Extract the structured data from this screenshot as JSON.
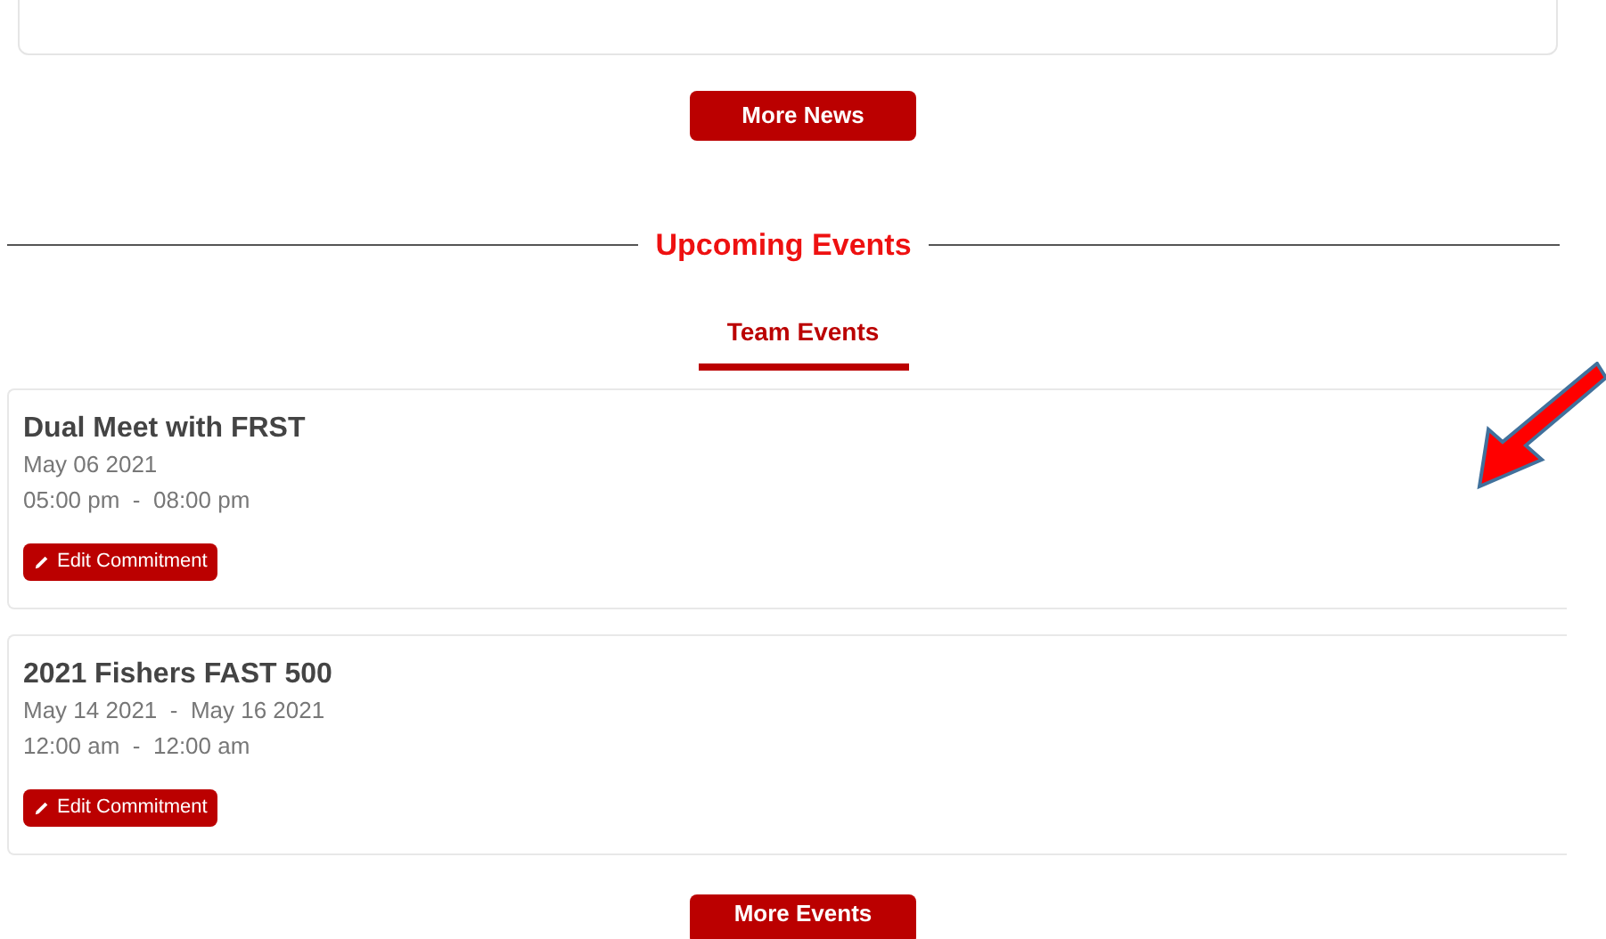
{
  "news_button": "More News",
  "section_title": "Upcoming Events",
  "tabs": [
    {
      "label": "Team Events",
      "selected": true
    }
  ],
  "events": [
    {
      "title": "Dual Meet with FRST",
      "date": "May 06 2021",
      "time": "05:00 pm  -  08:00 pm",
      "button": "Edit Commitment"
    },
    {
      "title": "2021 Fishers FAST 500",
      "date": "May 14 2021  -  May 16 2021",
      "time": "12:00 am  -  12:00 am",
      "button": "Edit Commitment"
    }
  ],
  "events_button": "More Events"
}
